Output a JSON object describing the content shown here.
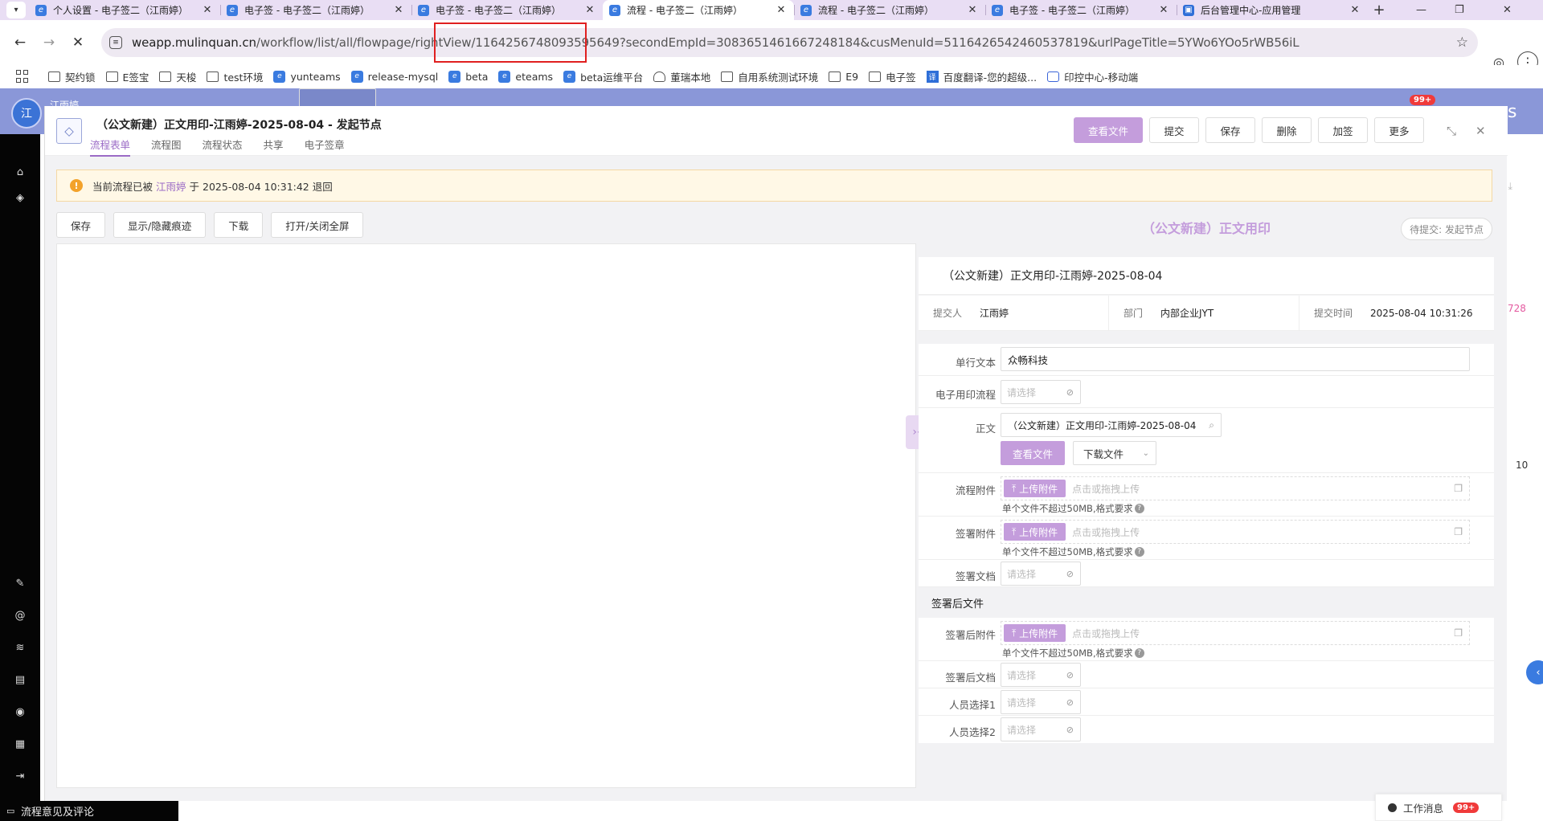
{
  "tabs": [
    {
      "title": "个人设置 - 电子签二（江雨婷）",
      "active": false
    },
    {
      "title": "电子签 - 电子签二（江雨婷）",
      "active": false
    },
    {
      "title": "电子签 - 电子签二（江雨婷）",
      "active": false
    },
    {
      "title": "流程 - 电子签二（江雨婷）",
      "active": true
    },
    {
      "title": "流程 - 电子签二（江雨婷）",
      "active": false
    },
    {
      "title": "电子签 - 电子签二（江雨婷）",
      "active": false
    },
    {
      "title": "后台管理中心-应用管理",
      "active": false
    }
  ],
  "address": {
    "host": "weapp.mulinquan.cn",
    "path": "/workflow/list/all/flowpage/rightView/1164256748093595649?secondEmpId=3083651461667248184&cusMenuId=5116426542460537819&urlPageTitle=5YWo6YOo5rWB56iL"
  },
  "bookmarks": [
    "契约锁",
    "E签宝",
    "天梭",
    "test环境",
    "yunteams",
    "release-mysql",
    "beta",
    "eteams",
    "beta运维平台",
    "董瑞本地",
    "自用系统测试环境",
    "E9",
    "电子签",
    "百度翻译-您的超级...",
    "印控中心-移动端"
  ],
  "app": {
    "user_initial": "江",
    "user_name": "江雨婷",
    "badge": "99+"
  },
  "panel": {
    "title": "（公文新建）正文用印-江雨婷-2025-08-04 - 发起节点",
    "nav": [
      "流程表单",
      "流程图",
      "流程状态",
      "共享",
      "电子签章"
    ],
    "buttons": [
      "查看文件",
      "提交",
      "保存",
      "删除",
      "加签",
      "更多"
    ]
  },
  "alert": {
    "prefix": "当前流程已被",
    "who": "江雨婷",
    "suffix": "于 2025-08-04 10:31:42 退回"
  },
  "doc_toolbar": [
    "保存",
    "显示/隐藏痕迹",
    "下载",
    "打开/关闭全屏"
  ],
  "form": {
    "title": "（公文新建）正文用印",
    "pending": "待提交: 发起节点",
    "subject": "（公文新建）正文用印-江雨婷-2025-08-04",
    "submitter_label": "提交人",
    "submitter": "江雨婷",
    "dept_label": "部门",
    "dept": "内部企业JYT",
    "time_label": "提交时间",
    "time": "2025-08-04 10:31:26",
    "fields": {
      "single_text_label": "单行文本",
      "single_text": "众畅科技",
      "esign_flow_label": "电子用印流程",
      "body_label": "正文",
      "body_value": "（公文新建）正文用印-江雨婷-2025-08-04",
      "view_file": "查看文件",
      "download_file": "下载文件",
      "flow_attach_label": "流程附件",
      "sign_attach_label": "签署附件",
      "sign_doc_label": "签署文档",
      "section_after": "签署后文件",
      "after_attach_label": "签署后附件",
      "after_doc_label": "签署后文档",
      "person1_label": "人员选择1",
      "person2_label": "人员选择2"
    },
    "select_placeholder": "请选择",
    "upload_button": "上传附件",
    "upload_hint": "点击或拖拽上传",
    "upload_note": "单个文件不超过50MB,格式要求"
  },
  "bottom": {
    "comments": "流程意见及评论",
    "messages": "工作消息",
    "msg_badge": "99+"
  },
  "background_text": {
    "a": "728",
    "b": "10",
    "c": "s"
  },
  "colors": {
    "accent": "#c49ddc",
    "tabbar": "#e9def4",
    "apphead": "#8a97d8",
    "alert_bg": "#fff8e6"
  }
}
